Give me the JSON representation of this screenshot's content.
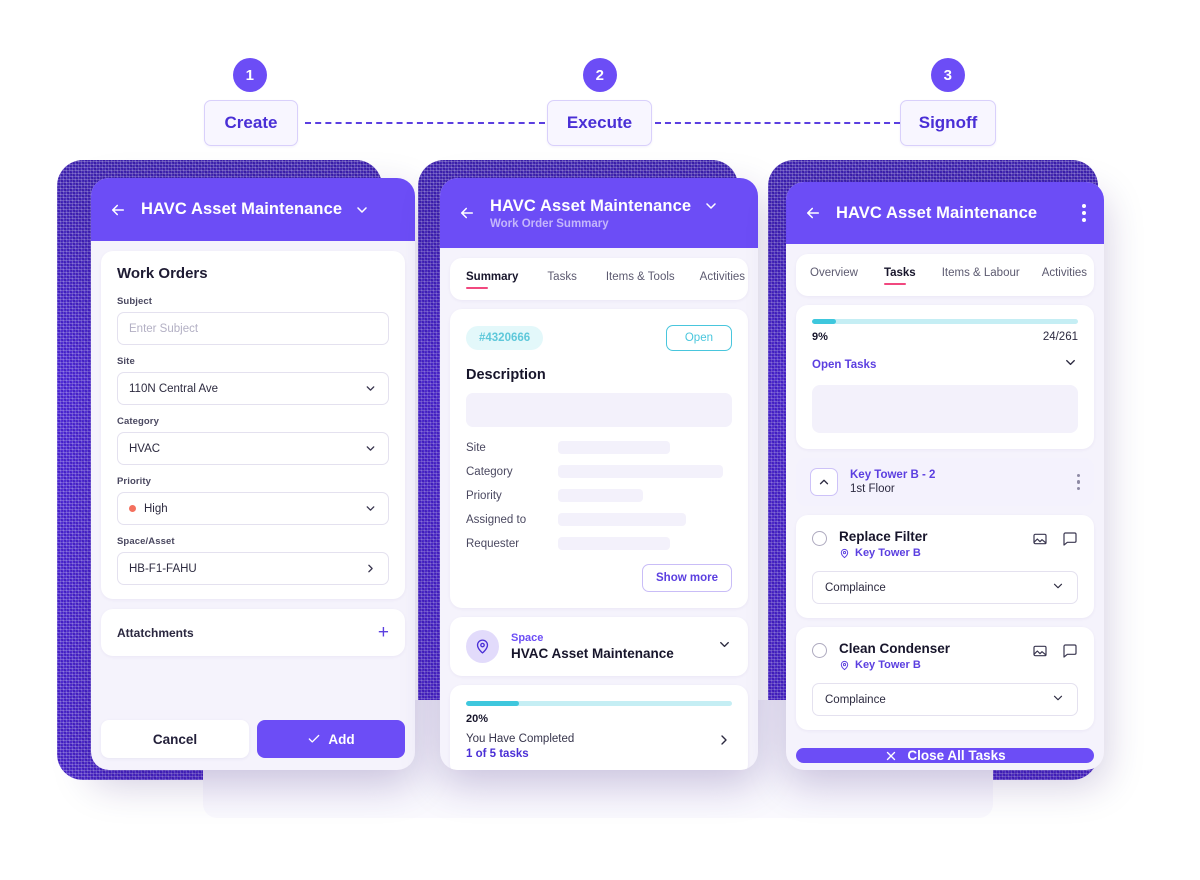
{
  "flow": {
    "steps": [
      {
        "num": "1",
        "label": "Create"
      },
      {
        "num": "2",
        "label": "Execute"
      },
      {
        "num": "3",
        "label": "Signoff"
      }
    ]
  },
  "colors": {
    "brand_purple": "#6c4df6",
    "deep_purple": "#4a2fd6",
    "teal": "#3ec7dd",
    "pink_underline": "#f1487f",
    "priority_high": "#f4705e"
  },
  "card_create": {
    "header": {
      "title": "HAVC Asset Maintenance",
      "back_icon": "arrow-left-icon",
      "chevron_icon": "chevron-down-icon"
    },
    "section_title": "Work Orders",
    "fields": [
      {
        "label": "Subject",
        "value": "",
        "placeholder": "Enter Subject",
        "control": "text"
      },
      {
        "label": "Site",
        "value": "110N Central Ave",
        "control": "select"
      },
      {
        "label": "Category",
        "value": "HVAC",
        "control": "select"
      },
      {
        "label": "Priority",
        "value": "High",
        "control": "select",
        "dot": true
      },
      {
        "label": "Space/Asset",
        "value": "HB-F1-FAHU",
        "control": "drill"
      }
    ],
    "attachments": {
      "label": "Attatchments",
      "add_icon": "plus-icon"
    },
    "cancel_label": "Cancel",
    "add_label": "Add"
  },
  "card_summary": {
    "header": {
      "title": "HAVC Asset Maintenance",
      "subtitle": "Work Order Summary"
    },
    "tabs": [
      {
        "label": "Summary",
        "active": true
      },
      {
        "label": "Tasks",
        "active": false
      },
      {
        "label": "Items & Tools",
        "active": false
      },
      {
        "label": "Activities",
        "active": false
      }
    ],
    "work_order_id": "#4320666",
    "status_label": "Open",
    "description_heading": "Description",
    "details": [
      {
        "key": "Site",
        "width": "42%"
      },
      {
        "key": "Category",
        "width": "62%"
      },
      {
        "key": "Priority",
        "width": "32%"
      },
      {
        "key": "Assigned to",
        "width": "48%"
      },
      {
        "key": "Requester",
        "width": "42%"
      }
    ],
    "show_more_label": "Show more",
    "space": {
      "label": "Space",
      "value": "HVAC Asset Maintenance",
      "icon": "location-pin-icon",
      "chevron_icon": "chevron-down-icon"
    },
    "progress": {
      "percent_label": "20%",
      "percent": 20,
      "line1": "You Have Completed",
      "line2": "1 of 5 tasks",
      "chevron_icon": "chevron-right-icon"
    }
  },
  "card_tasks": {
    "header": {
      "title": "HAVC Asset Maintenance",
      "menu_icon": "kebab-menu-icon"
    },
    "tabs": [
      {
        "label": "Overview",
        "active": false
      },
      {
        "label": "Tasks",
        "active": true
      },
      {
        "label": "Items & Labour",
        "active": false
      },
      {
        "label": "Activities",
        "active": false
      }
    ],
    "progress": {
      "percent_label": "9%",
      "percent": 9,
      "fraction": "24/261"
    },
    "open_tasks_label": "Open Tasks",
    "group": {
      "title": "Key Tower B - 2",
      "subtitle": "1st Floor",
      "collapse_icon": "chevron-up-icon",
      "menu_icon": "kebab-menu-icon"
    },
    "tasks": [
      {
        "name": "Replace Filter",
        "location": "Key Tower B",
        "select_value": "Complaince",
        "photo_icon": "image-icon",
        "comment_icon": "comment-icon",
        "checkbox_icon": "radio-unchecked-icon"
      },
      {
        "name": "Clean Condenser",
        "location": "Key Tower B",
        "select_value": "Complaince",
        "photo_icon": "image-icon",
        "comment_icon": "comment-icon",
        "checkbox_icon": "radio-unchecked-icon"
      }
    ],
    "close_all_label": "Close All Tasks",
    "close_icon": "x-icon"
  }
}
